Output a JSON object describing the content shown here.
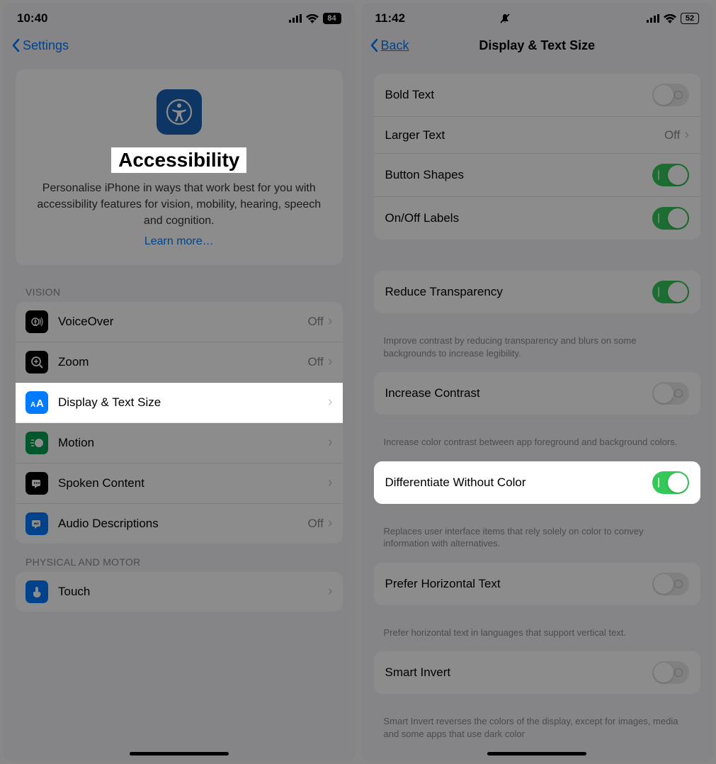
{
  "left": {
    "status_time": "10:40",
    "battery": "84",
    "back_label": "Settings",
    "hero_title": "Accessibility",
    "hero_desc": "Personalise iPhone in ways that work best for you with accessibility features for vision, mobility, hearing, speech and cognition.",
    "learn_more": "Learn more…",
    "section1": "VISION",
    "rows": [
      {
        "label": "VoiceOver",
        "value": "Off",
        "icon": "voiceover",
        "bg": "ic-black"
      },
      {
        "label": "Zoom",
        "value": "Off",
        "icon": "zoom",
        "bg": "ic-black"
      },
      {
        "label": "Display & Text Size",
        "value": "",
        "icon": "textsize",
        "bg": "ic-blue",
        "highlight": true
      },
      {
        "label": "Motion",
        "value": "",
        "icon": "motion",
        "bg": "ic-green"
      },
      {
        "label": "Spoken Content",
        "value": "",
        "icon": "spoken",
        "bg": "ic-black"
      },
      {
        "label": "Audio Descriptions",
        "value": "Off",
        "icon": "audiodesc",
        "bg": "ic-blue"
      }
    ],
    "section2": "PHYSICAL AND MOTOR",
    "rows2": [
      {
        "label": "Touch",
        "icon": "touch",
        "bg": "ic-blue"
      }
    ]
  },
  "right": {
    "status_time": "11:42",
    "battery": "52",
    "back_label": "Back",
    "title": "Display & Text Size",
    "group1": [
      {
        "label": "Bold Text",
        "toggle": "off"
      },
      {
        "label": "Larger Text",
        "value": "Off",
        "nav": true
      },
      {
        "label": "Button Shapes",
        "toggle": "on"
      },
      {
        "label": "On/Off Labels",
        "toggle": "on"
      }
    ],
    "group2": [
      {
        "label": "Reduce Transparency",
        "toggle": "on"
      }
    ],
    "foot2": "Improve contrast by reducing transparency and blurs on some backgrounds to increase legibility.",
    "group3": [
      {
        "label": "Increase Contrast",
        "toggle": "off"
      }
    ],
    "foot3": "Increase color contrast between app foreground and background colors.",
    "group4": [
      {
        "label": "Differentiate Without Color",
        "toggle": "on",
        "highlight": true
      }
    ],
    "foot4": "Replaces user interface items that rely solely on color to convey information with alternatives.",
    "group5": [
      {
        "label": "Prefer Horizontal Text",
        "toggle": "off"
      }
    ],
    "foot5": "Prefer horizontal text in languages that support vertical text.",
    "group6": [
      {
        "label": "Smart Invert",
        "toggle": "off"
      }
    ],
    "foot6": "Smart Invert reverses the colors of the display, except for images, media and some apps that use dark color"
  }
}
